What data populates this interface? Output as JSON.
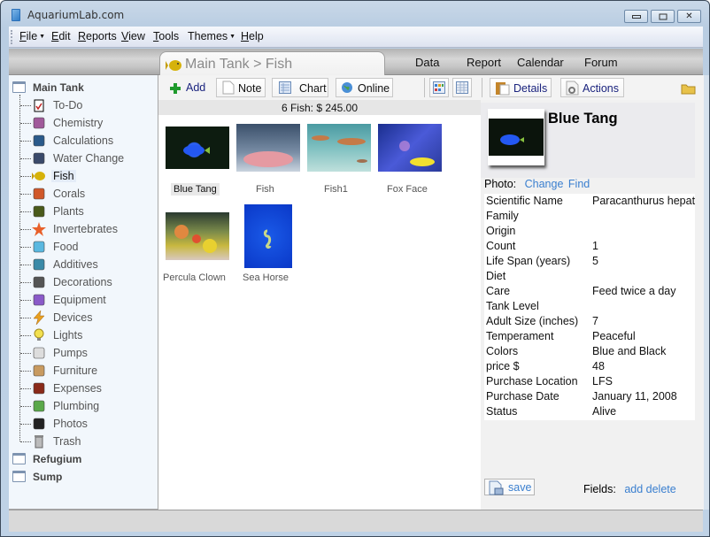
{
  "window": {
    "title": "AquariumLab.com",
    "controls": {
      "minimize": "minimize",
      "maximize": "maximize",
      "close": "close"
    }
  },
  "menu": [
    {
      "label": "File",
      "mnemonic": "F",
      "rest": "ile",
      "has_dropdown": true
    },
    {
      "label": "Edit",
      "mnemonic": "E",
      "rest": "dit",
      "has_dropdown": false
    },
    {
      "label": "Reports",
      "mnemonic": "R",
      "rest": "eports",
      "has_dropdown": false
    },
    {
      "label": "View",
      "mnemonic": "V",
      "rest": "iew",
      "has_dropdown": false
    },
    {
      "label": "Tools",
      "mnemonic": "T",
      "rest": "ools",
      "has_dropdown": false
    },
    {
      "label": "Themes",
      "mnemonic": "",
      "rest": "Themes",
      "has_dropdown": true
    },
    {
      "label": "Help",
      "mnemonic": "H",
      "rest": "elp",
      "has_dropdown": false
    }
  ],
  "tabs": {
    "active": "Main Tank > Fish",
    "others": [
      "Data",
      "Report",
      "Calendar",
      "Forum"
    ]
  },
  "sidebar": {
    "roots": [
      "Main Tank",
      "Refugium",
      "Sump"
    ],
    "items": [
      {
        "label": "To-Do",
        "icon": "clipboard-check-icon"
      },
      {
        "label": "Chemistry",
        "icon": "flask-icon"
      },
      {
        "label": "Calculations",
        "icon": "calculator-icon"
      },
      {
        "label": "Water Change",
        "icon": "water-bucket-icon"
      },
      {
        "label": "Fish",
        "icon": "fish-icon",
        "selected": true
      },
      {
        "label": "Corals",
        "icon": "coral-icon"
      },
      {
        "label": "Plants",
        "icon": "plant-icon"
      },
      {
        "label": "Invertebrates",
        "icon": "starfish-icon"
      },
      {
        "label": "Food",
        "icon": "food-icon"
      },
      {
        "label": "Additives",
        "icon": "syringe-icon"
      },
      {
        "label": "Decorations",
        "icon": "rock-icon"
      },
      {
        "label": "Equipment",
        "icon": "equipment-icon"
      },
      {
        "label": "Devices",
        "icon": "lightning-icon"
      },
      {
        "label": "Lights",
        "icon": "lightbulb-icon"
      },
      {
        "label": "Pumps",
        "icon": "pump-icon"
      },
      {
        "label": "Furniture",
        "icon": "furniture-icon"
      },
      {
        "label": "Expenses",
        "icon": "money-icon"
      },
      {
        "label": "Plumbing",
        "icon": "pipe-icon"
      },
      {
        "label": "Photos",
        "icon": "camera-icon"
      },
      {
        "label": "Trash",
        "icon": "trash-icon"
      }
    ]
  },
  "toolbar": {
    "add": "Add",
    "note": "Note",
    "chart": "Chart",
    "online": "Online",
    "details": "Details",
    "actions": "Actions"
  },
  "summary": "6 Fish: $ 245.00",
  "gallery": [
    {
      "caption": "Blue Tang",
      "selected": true
    },
    {
      "caption": "Fish"
    },
    {
      "caption": "Fish1"
    },
    {
      "caption": "Fox Face"
    },
    {
      "caption": "Percula Clown"
    },
    {
      "caption": "Sea Horse"
    }
  ],
  "details": {
    "name": "Blue Tang",
    "photo_label": "Photo:",
    "photo_change": "Change",
    "photo_find": "Find",
    "fields": [
      {
        "key": "Scientific Name",
        "value": "Paracanthurus hepatus"
      },
      {
        "key": "Family",
        "value": ""
      },
      {
        "key": "Origin",
        "value": ""
      },
      {
        "key": "Count",
        "value": "1"
      },
      {
        "key": "Life Span (years)",
        "value": "5"
      },
      {
        "key": "Diet",
        "value": ""
      },
      {
        "key": "Care",
        "value": "Feed twice a day"
      },
      {
        "key": "Tank Level",
        "value": ""
      },
      {
        "key": "Adult Size (inches)",
        "value": "7"
      },
      {
        "key": "Temperament",
        "value": "Peaceful"
      },
      {
        "key": "Colors",
        "value": "Blue and Black"
      },
      {
        "key": "price $",
        "value": "48"
      },
      {
        "key": "Purchase Location",
        "value": "LFS"
      },
      {
        "key": "Purchase Date",
        "value": "January 11, 2008"
      },
      {
        "key": "Status",
        "value": "Alive"
      }
    ],
    "save": "save",
    "fields_label": "Fields:",
    "fields_add": "add",
    "fields_delete": "delete"
  }
}
